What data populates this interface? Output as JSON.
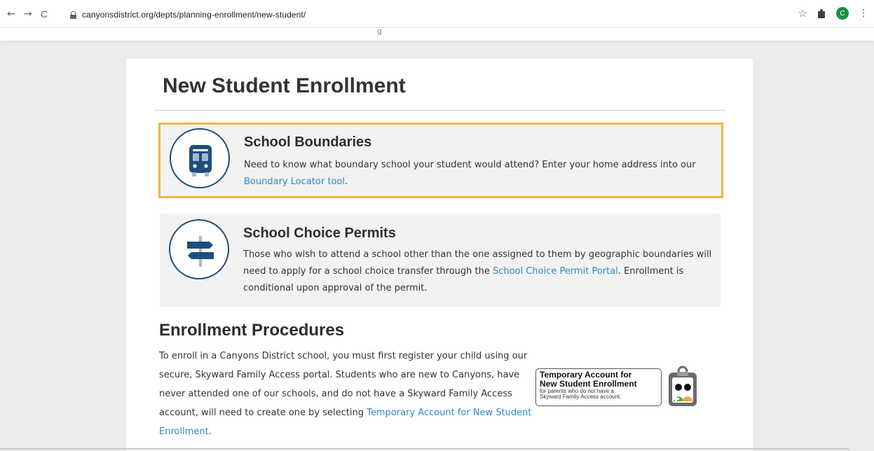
{
  "browser": {
    "back": "←",
    "forward": "→",
    "reload": "C",
    "url": "canyonsdistrict.org/depts/planning-enrollment/new-student/",
    "profile_initial": "C",
    "star": "☆",
    "menu": "⋮"
  },
  "page": {
    "title": "New Student Enrollment",
    "strip_ghost_text": "g"
  },
  "boundaries": {
    "heading": "School Boundaries",
    "text_before_link": "Need to know what boundary school your student would attend? Enter your home address into our ",
    "link": "Boundary Locator tool",
    "text_after_link": "."
  },
  "choice": {
    "heading": "School Choice Permits",
    "text_before_link": "Those who wish to attend a school other than the one assigned to them by geographic boundaries will need to apply for a school choice transfer through the ",
    "link": "School Choice Permit Portal",
    "text_after_link": ". Enrollment is conditional upon approval of the permit."
  },
  "procedures": {
    "heading": "Enrollment Procedures",
    "text_before_link": "To enroll in a Canyons District school, you must first register your child using our secure, Skyward Family Access portal. Students who are new to Canyons, have never attended one of our schools, and do not have a Skyward Family Access account, will need to create one by selecting ",
    "link": "Temporary Account for New Student Enrollment",
    "text_after_link": "."
  },
  "temp_badge": {
    "line1": "Temporary Account for",
    "line2": "New Student Enrollment",
    "line3": "for parents who do not have a",
    "line4": "Skyward Family Access account."
  },
  "colors": {
    "accent_border": "#f0b543",
    "link": "#2e8bc0",
    "icon_blue": "#1e4f7a",
    "box_bg": "#f2f2f2"
  }
}
